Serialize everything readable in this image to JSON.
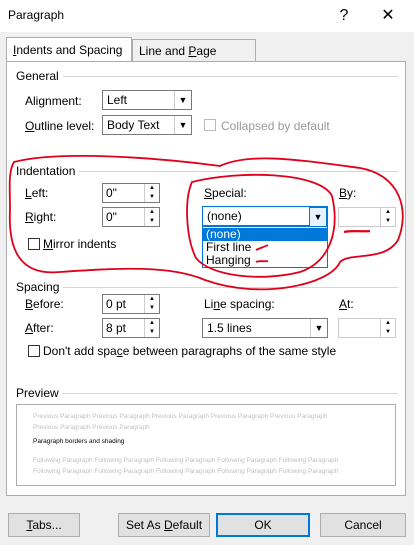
{
  "window": {
    "title": "Paragraph",
    "help_label": "?",
    "close_label": "✕"
  },
  "tabs": [
    {
      "label": "Indents and Spacing",
      "active": true
    },
    {
      "label": "Line and Page Breaks",
      "active": false
    }
  ],
  "general": {
    "heading": "General",
    "alignment_label": "Alignment:",
    "alignment_value": "Left",
    "outline_label": "Outline level:",
    "outline_value": "Body Text",
    "collapsed_label": "Collapsed by default"
  },
  "indentation": {
    "heading": "Indentation",
    "left_label": "Left:",
    "left_value": "0\"",
    "right_label": "Right:",
    "right_value": "0\"",
    "mirror_label": "Mirror indents",
    "special_label": "Special:",
    "special_value": "(none)",
    "special_options": [
      "(none)",
      "First line",
      "Hanging"
    ],
    "by_label": "By:",
    "by_value": ""
  },
  "spacing": {
    "heading": "Spacing",
    "before_label": "Before:",
    "before_value": "0 pt",
    "after_label": "After:",
    "after_value": "8 pt",
    "line_spacing_label": "Line spacing:",
    "line_spacing_value": "1.5 lines",
    "at_label": "At:",
    "at_value": "",
    "dont_add_label": "Don't add space between paragraphs of the same style"
  },
  "preview": {
    "heading": "Preview",
    "previous_text": "Previous Paragraph Previous Paragraph Previous Paragraph Previous Paragraph Previous Paragraph",
    "previous_text_2": "Previous Paragraph Previous Paragraph",
    "sample_text": "Paragraph borders and shading",
    "following_text": "Following Paragraph Following Paragraph Following Paragraph Following Paragraph Following Paragraph"
  },
  "buttons": {
    "tabs": "Tabs...",
    "set_default": "Set As Default",
    "ok": "OK",
    "cancel": "Cancel"
  },
  "colors": {
    "accent": "#0078d7",
    "annotation": "#e0001b"
  }
}
